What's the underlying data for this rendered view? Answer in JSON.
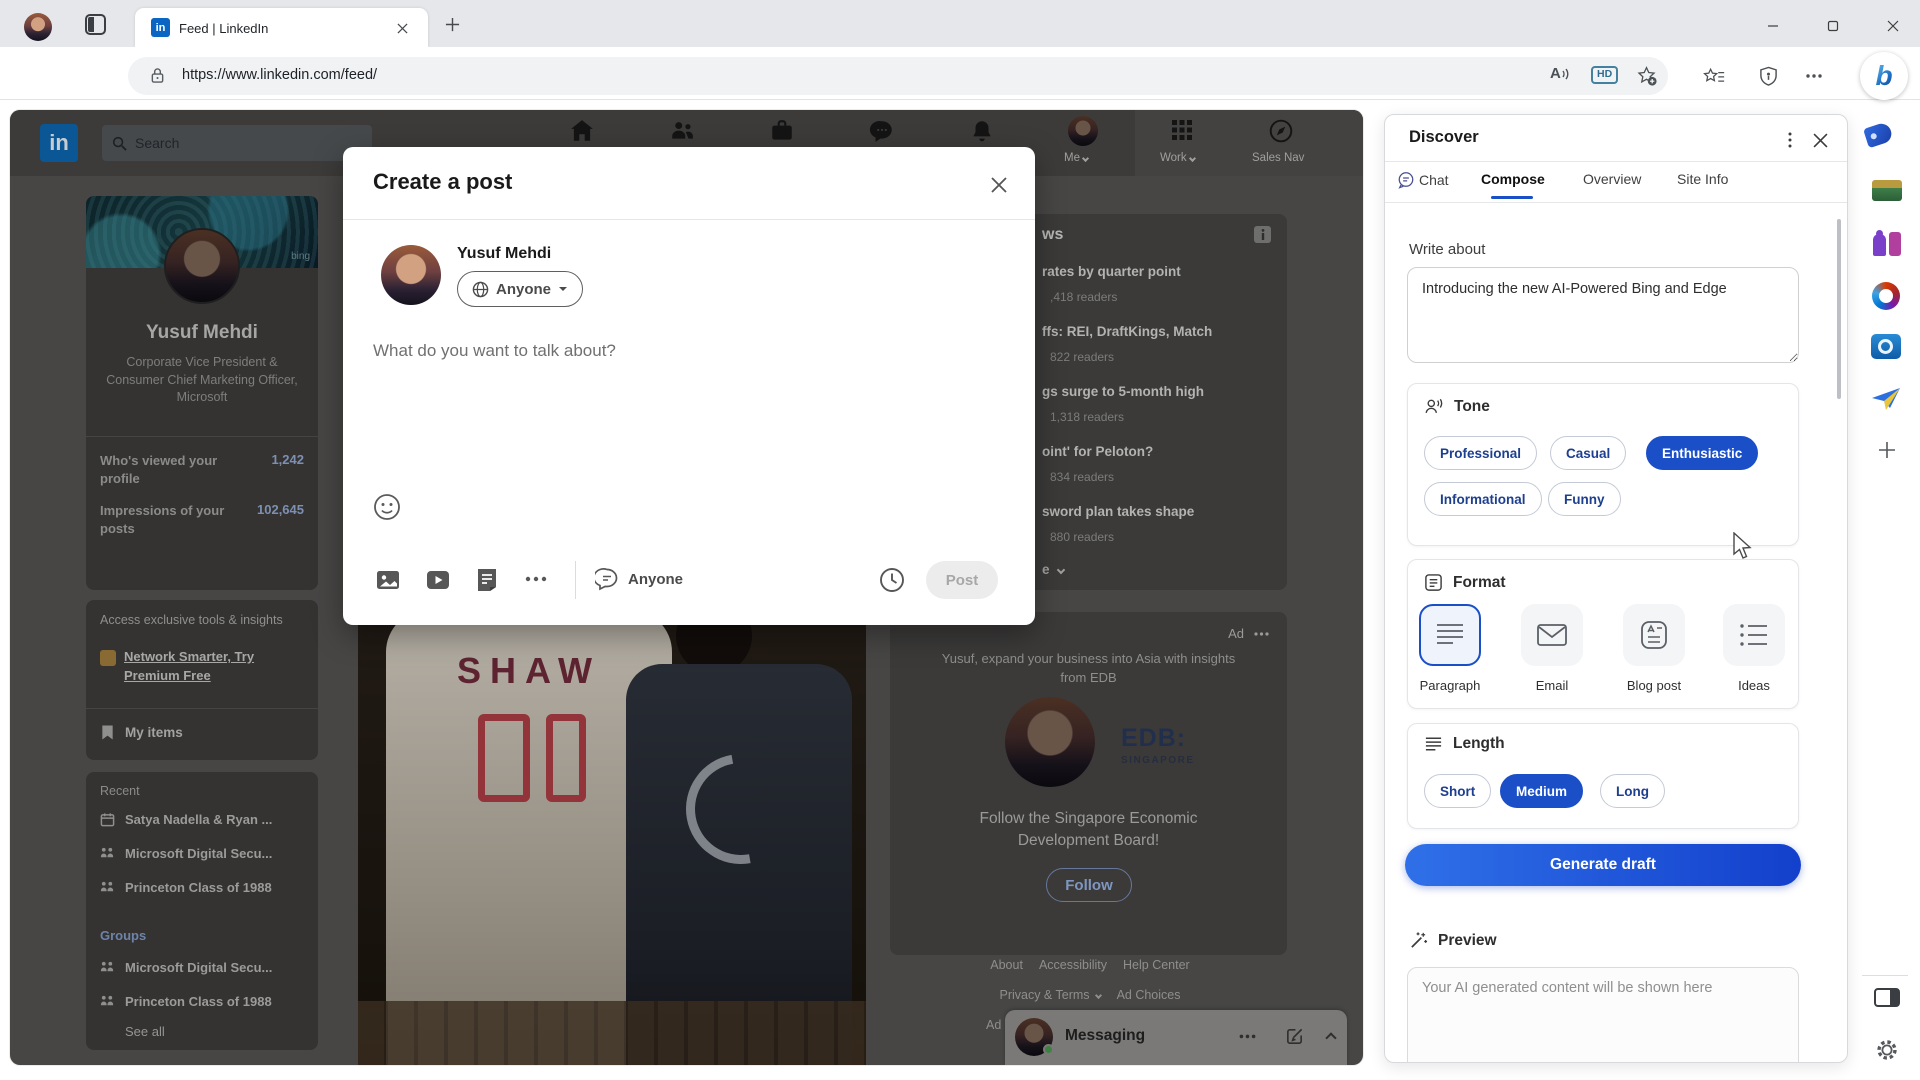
{
  "browser": {
    "tab_title": "Feed | LinkedIn",
    "url": "https://www.linkedin.com/feed/",
    "read_aloud_letter": "A",
    "hd_badge": "HD",
    "bing_letter": "b"
  },
  "edge_sidebar": {
    "icons": [
      "bing-chat",
      "shopping",
      "toolbox",
      "games",
      "microsoft-365",
      "outlook",
      "designer",
      "add-to-sidebar",
      "toggle-sidebar",
      "settings"
    ]
  },
  "linkedin": {
    "logo_text": "in",
    "search_placeholder": "Search",
    "nav": {
      "me": "Me",
      "work": "Work",
      "sales_nav": "Sales Nav"
    },
    "profile": {
      "name": "Yusuf Mehdi",
      "headline": "Corporate Vice President & Consumer Chief Marketing Officer, Microsoft",
      "banner_brand": "bing",
      "stat1_label": "Who's viewed your profile",
      "stat1_value": "1,242",
      "stat2_label": "Impressions of your posts",
      "stat2_value": "102,645"
    },
    "premium": {
      "intro": "Access exclusive tools & insights",
      "link": "Network Smarter, Try Premium Free"
    },
    "my_items": "My items",
    "recent": {
      "label": "Recent",
      "items": [
        "Satya Nadella & Ryan ...",
        "Microsoft Digital Secu...",
        "Princeton Class of 1988"
      ]
    },
    "groups": {
      "label": "Groups",
      "items": [
        "Microsoft Digital Secu...",
        "Princeton Class of 1988"
      ],
      "see_all": "See all"
    },
    "news": {
      "title_fragment": "ws",
      "items": [
        {
          "headline": "rates by quarter point",
          "readers": ",418 readers"
        },
        {
          "headline": "ffs: REI, DraftKings, Match",
          "readers": "822 readers"
        },
        {
          "headline": "gs surge to 5-month high",
          "readers": "1,318 readers"
        },
        {
          "headline": "oint' for Peloton?",
          "readers": "834 readers"
        },
        {
          "headline": "sword plan takes shape",
          "readers": "880 readers"
        }
      ],
      "show_more_fragment": "e"
    },
    "ad": {
      "label": "Ad",
      "intro": "Yusuf, expand your business into Asia with insights from EDB",
      "logo_line1": "EDB:",
      "logo_line2": "SINGAPORE",
      "cta": "Follow the Singapore Economic Development Board!",
      "button": "Follow"
    },
    "footer": {
      "row1": [
        "About",
        "Accessibility",
        "Help Center"
      ],
      "privacy": "Privacy & Terms",
      "ad_choices": "Ad Choices",
      "ad_fragment": "Ad"
    },
    "messaging": "Messaging",
    "photo_jersey": "SHAW"
  },
  "modal": {
    "title": "Create a post",
    "author": "Yusuf Mehdi",
    "visibility": "Anyone",
    "placeholder": "What do you want to talk about?",
    "comment_setting": "Anyone",
    "post_button": "Post"
  },
  "discover": {
    "title": "Discover",
    "tabs": [
      "Chat",
      "Compose",
      "Overview",
      "Site Info"
    ],
    "write_about_label": "Write about",
    "write_about_value": "Introducing the new AI-Powered Bing and Edge",
    "tone": {
      "label": "Tone",
      "options": [
        "Professional",
        "Casual",
        "Enthusiastic",
        "Informational",
        "Funny"
      ],
      "selected": "Enthusiastic"
    },
    "format": {
      "label": "Format",
      "options": [
        "Paragraph",
        "Email",
        "Blog post",
        "Ideas"
      ],
      "selected": "Paragraph"
    },
    "length": {
      "label": "Length",
      "options": [
        "Short",
        "Medium",
        "Long"
      ],
      "selected": "Medium"
    },
    "generate_button": "Generate draft",
    "preview_label": "Preview",
    "preview_placeholder": "Your AI generated content will be shown here"
  },
  "colors": {
    "linkedin_blue": "#0a66c2",
    "copilot_selected": "#1a4fc8",
    "generate_gradient_start": "#2f70e8",
    "generate_gradient_end": "#1340cc"
  }
}
